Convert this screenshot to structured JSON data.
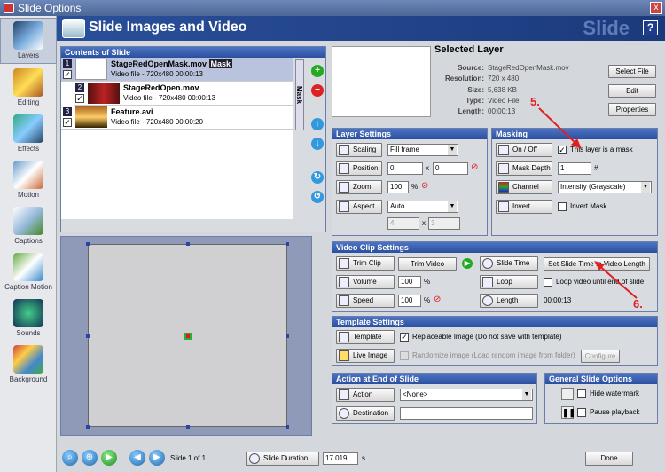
{
  "window": {
    "title": "Slide Options",
    "close_glyph": "x"
  },
  "header": {
    "title": "Slide Images and Video",
    "brand": "Slide",
    "help": "?"
  },
  "sidebar": {
    "items": [
      {
        "label": "Layers",
        "icon": "layers-icon",
        "active": true
      },
      {
        "label": "Editing",
        "icon": "editing-icon"
      },
      {
        "label": "Effects",
        "icon": "effects-icon"
      },
      {
        "label": "Motion",
        "icon": "motion-icon"
      },
      {
        "label": "Captions",
        "icon": "captions-icon"
      },
      {
        "label": "Caption Motion",
        "icon": "caption-motion-icon"
      },
      {
        "label": "Sounds",
        "icon": "sounds-icon"
      },
      {
        "label": "Background",
        "icon": "background-icon"
      }
    ]
  },
  "contents": {
    "title": "Contents of Slide",
    "mask_label": "Mask",
    "layers": [
      {
        "num": "1",
        "name": "StageRedOpenMask.mov",
        "badge": "Mask",
        "info": "Video file - 720x480 00:00:13"
      },
      {
        "num": "2",
        "name": "StageRedOpen.mov",
        "info": "Video file - 720x480 00:00:13"
      },
      {
        "num": "3",
        "name": "Feature.avi",
        "info": "Video file - 720x480 00:00:20"
      }
    ]
  },
  "selected": {
    "title": "Selected Layer",
    "source_label": "Source:",
    "source": "StageRedOpenMask.mov",
    "resolution_label": "Resolution:",
    "resolution": "720 x 480",
    "size_label": "Size:",
    "size": "5,638 KB",
    "type_label": "Type:",
    "type": "Video File",
    "length_label": "Length:",
    "length": "00:00:13",
    "select_file": "Select File",
    "edit": "Edit",
    "properties": "Properties"
  },
  "layer_settings": {
    "title": "Layer Settings",
    "scaling": "Scaling",
    "scaling_value": "Fill frame",
    "position": "Position",
    "pos_x": "0",
    "pos_y": "0",
    "x_sep": "x",
    "zoom": "Zoom",
    "zoom_value": "100",
    "pct": "%",
    "aspect": "Aspect",
    "aspect_value": "Auto",
    "aspect_w": "4",
    "aspect_h": "3"
  },
  "masking": {
    "title": "Masking",
    "on_off": "On / Off",
    "is_mask": "This layer is a mask",
    "mask_depth": "Mask Depth",
    "depth_value": "1",
    "hash": "#",
    "channel": "Channel",
    "channel_value": "Intensity (Grayscale)",
    "invert": "Invert",
    "invert_mask": "Invert Mask"
  },
  "video_clip": {
    "title": "Video Clip Settings",
    "trim_clip": "Trim Clip",
    "trim_video": "Trim Video",
    "slide_time": "Slide Time",
    "set_slide_time": "Set Slide Time to Video Length",
    "volume": "Volume",
    "volume_value": "100",
    "loop": "Loop",
    "loop_text": "Loop video until end of slide",
    "speed": "Speed",
    "speed_value": "100",
    "length": "Length",
    "length_value": "00:00:13",
    "pct": "%"
  },
  "template": {
    "title": "Template Settings",
    "template": "Template",
    "replaceable": "Replaceable Image (Do not save with template)",
    "live_image": "Live Image",
    "randomize": "Randomize image (Load random image from folder)",
    "configure": "Configure"
  },
  "action": {
    "title": "Action at End of Slide",
    "action": "Action",
    "action_value": "<None>",
    "destination": "Destination"
  },
  "general": {
    "title": "General Slide Options",
    "hide_watermark": "Hide watermark",
    "pause_playback": "Pause playback"
  },
  "bottom": {
    "slide_of": "Slide 1 of 1",
    "duration_label": "Slide Duration",
    "duration_value": "17.019",
    "unit": "s",
    "done": "Done"
  },
  "annotations": {
    "a5": "5.",
    "a6": "6."
  }
}
